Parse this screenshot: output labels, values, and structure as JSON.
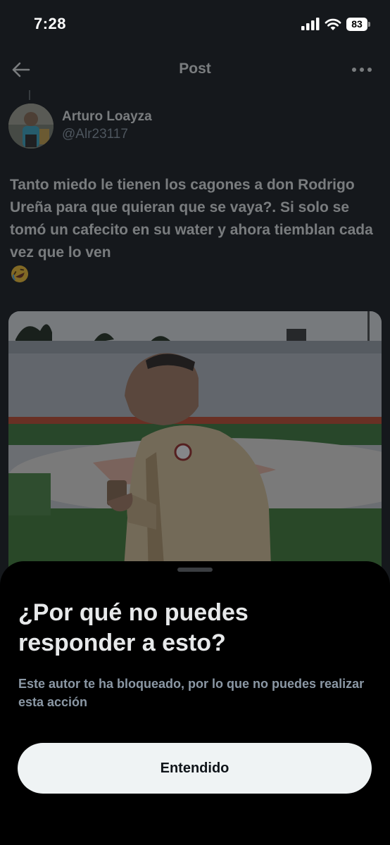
{
  "status_bar": {
    "time": "7:28",
    "battery": "83",
    "icons": [
      "signal-icon",
      "wifi-icon",
      "battery-icon"
    ]
  },
  "nav": {
    "title": "Post",
    "back_icon": "arrow-left-icon",
    "more_icon": "more-horizontal-icon"
  },
  "post": {
    "author_name": "Arturo Loayza",
    "author_handle": "@Alr23117",
    "text": "Tanto miedo le tienen los cagones a don Rodrigo Ureña para que quieran que se vaya?. Si solo se tomó un cafecito en su water y ahora tiemblan cada vez que lo ven",
    "emoji": "rolling-on-floor-laughing-emoji",
    "media_icon": "photo-of-man-holding-cup-in-stadium"
  },
  "sheet": {
    "title": "¿Por qué no puedes responder a esto?",
    "description": "Este autor te ha bloqueado, por lo que no puedes realizar esta acción",
    "button_label": "Entendido"
  },
  "colors": {
    "background": "#15181c",
    "sheet_background": "#000000",
    "primary_text": "#e7e9ea",
    "secondary_text": "#8b98a5",
    "button_background": "#eff3f4",
    "button_text": "#0f1419"
  }
}
